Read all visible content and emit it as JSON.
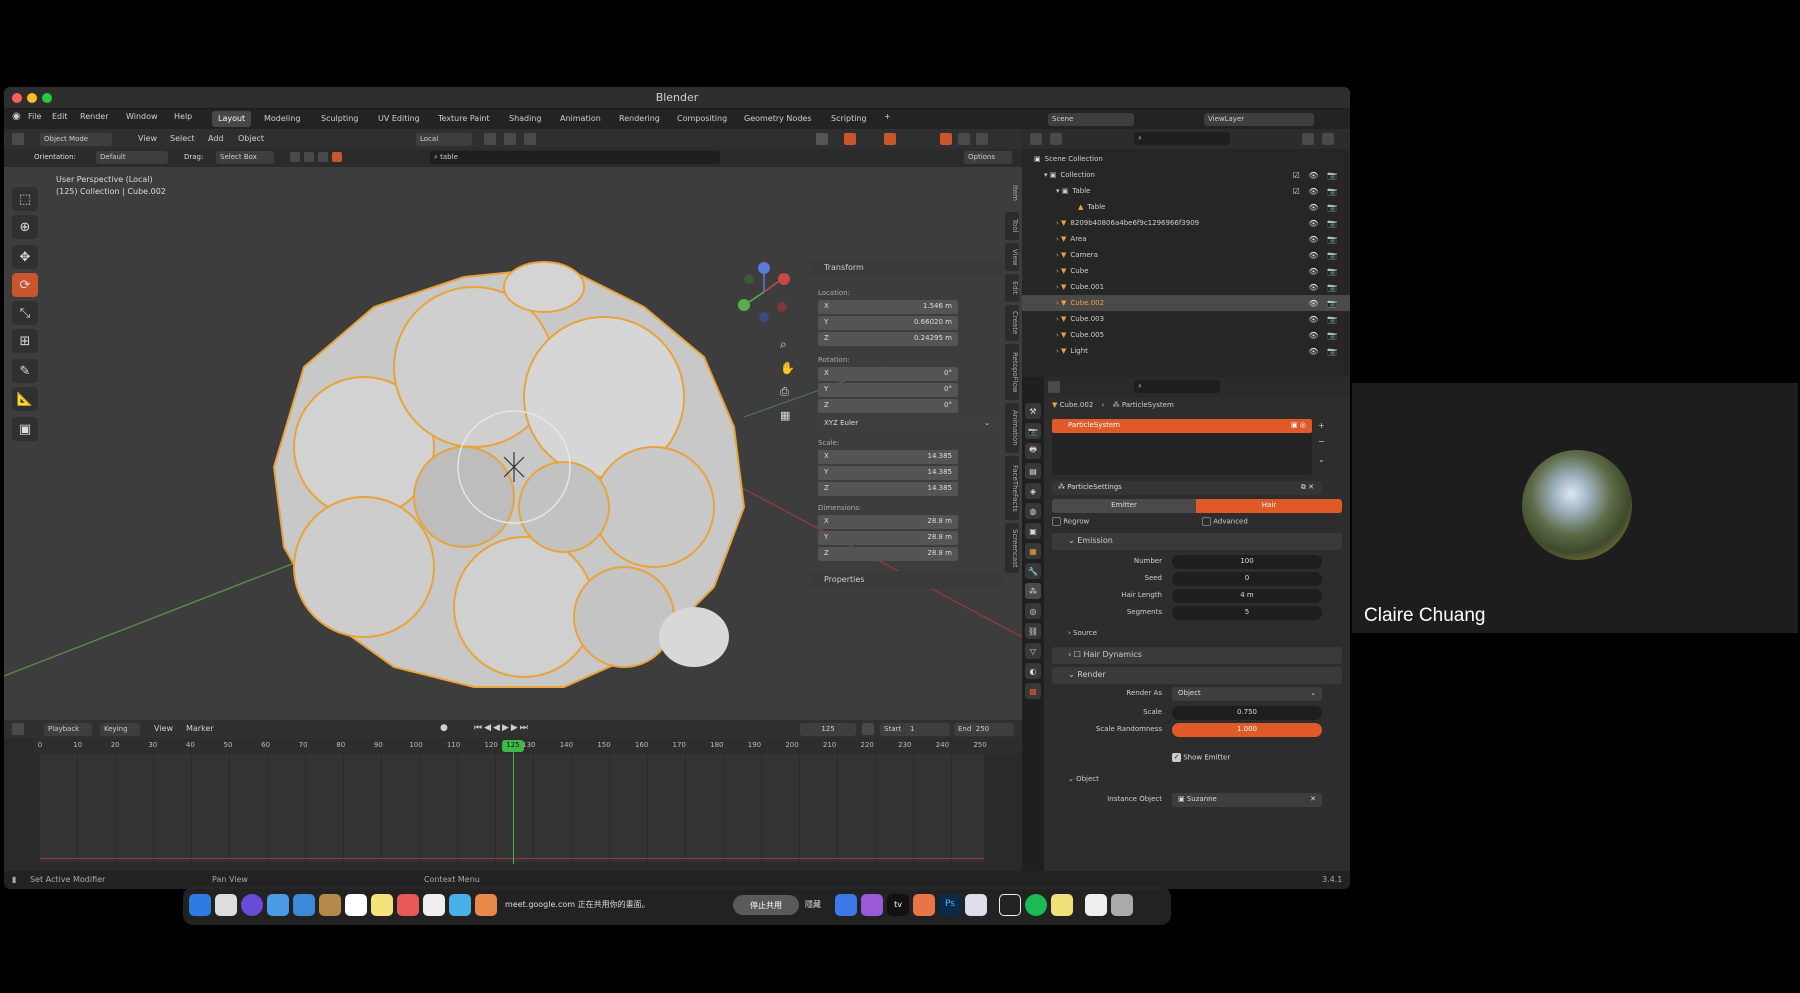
{
  "window": {
    "title": "Blender"
  },
  "menu": [
    "File",
    "Edit",
    "Render",
    "Window",
    "Help"
  ],
  "workspaces": [
    "Layout",
    "Modeling",
    "Sculpting",
    "UV Editing",
    "Texture Paint",
    "Shading",
    "Animation",
    "Rendering",
    "Compositing",
    "Geometry Nodes",
    "Scripting"
  ],
  "topbar": {
    "scene": "Scene",
    "view_layer": "ViewLayer"
  },
  "header": {
    "mode": "Object Mode",
    "view": "View",
    "select": "Select",
    "add": "Add",
    "object": "Object",
    "transform_pivot": "Local",
    "orientation_label": "Orientation:",
    "orientation": "Default",
    "drag_label": "Drag:",
    "drag": "Select Box",
    "options": "Options"
  },
  "viewport": {
    "perspective": "User Perspective (Local)",
    "collection": "(125) Collection | Cube.002"
  },
  "npanel": {
    "header": "Transform",
    "location_label": "Location:",
    "location": [
      {
        "axis": "X",
        "value": "1.546 m"
      },
      {
        "axis": "Y",
        "value": "0.66020 m"
      },
      {
        "axis": "Z",
        "value": "0.24295 m"
      }
    ],
    "rotation_label": "Rotation:",
    "rotation": [
      {
        "axis": "X",
        "value": "0°"
      },
      {
        "axis": "Y",
        "value": "0°"
      },
      {
        "axis": "Z",
        "value": "0°"
      }
    ],
    "rotation_mode": "XYZ Euler",
    "scale_label": "Scale:",
    "scale": [
      {
        "axis": "X",
        "value": "14.385"
      },
      {
        "axis": "Y",
        "value": "14.385"
      },
      {
        "axis": "Z",
        "value": "14.385"
      }
    ],
    "dimensions_label": "Dimensions:",
    "dimensions": [
      {
        "axis": "X",
        "value": "28.8 m"
      },
      {
        "axis": "Y",
        "value": "28.8 m"
      },
      {
        "axis": "Z",
        "value": "28.8 m"
      }
    ],
    "properties": "Properties",
    "tabs": [
      "Item",
      "Tool",
      "View",
      "Edit",
      "Create",
      "RetopoFlow",
      "Animation",
      "FaceTheFacts",
      "Screencast"
    ]
  },
  "timeline": {
    "playback": "Playback",
    "keying": "Keying",
    "view": "View",
    "marker": "Marker",
    "current_frame": "125",
    "start_label": "Start",
    "start": "1",
    "end_label": "End",
    "end": "250",
    "ticks": [
      "0",
      "10",
      "20",
      "30",
      "40",
      "50",
      "60",
      "70",
      "80",
      "90",
      "100",
      "110",
      "120",
      "130",
      "140",
      "150",
      "160",
      "170",
      "180",
      "190",
      "200",
      "210",
      "220",
      "230",
      "240",
      "250"
    ],
    "playhead_label": "125"
  },
  "statusbar": {
    "left": "Set Active Modifier",
    "mid": "Pan View",
    "right": "Context Menu",
    "version": "3.4.1"
  },
  "outliner": {
    "root": "Scene Collection",
    "rows": [
      {
        "name": "Collection",
        "indent": 1
      },
      {
        "name": "Table",
        "indent": 2
      },
      {
        "name": "Table",
        "indent": 3
      },
      {
        "name": "8209b40806a4be6f9c1296966f3909",
        "indent": 2
      },
      {
        "name": "Area",
        "indent": 2
      },
      {
        "name": "Camera",
        "indent": 2
      },
      {
        "name": "Cube",
        "indent": 2
      },
      {
        "name": "Cube.001",
        "indent": 2
      },
      {
        "name": "Cube.002",
        "indent": 2,
        "selected": true
      },
      {
        "name": "Cube.003",
        "indent": 2
      },
      {
        "name": "Cube.005",
        "indent": 2
      },
      {
        "name": "Light",
        "indent": 2
      }
    ]
  },
  "properties": {
    "breadcrumb_object": "Cube.002",
    "breadcrumb_system": "ParticleSystem",
    "system_item": "ParticleSystem",
    "settings_name": "ParticleSettings",
    "type_emitter": "Emitter",
    "type_hair": "Hair",
    "regrow": "Regrow",
    "advanced": "Advanced",
    "emission": "Emission",
    "number_label": "Number",
    "number": "100",
    "seed_label": "Seed",
    "seed": "0",
    "hair_length_label": "Hair Length",
    "hair_length": "4 m",
    "segments_label": "Segments",
    "segments": "5",
    "source": "Source",
    "hair_dynamics": "Hair Dynamics",
    "render": "Render",
    "render_as_label": "Render As",
    "render_as": "Object",
    "scale_label": "Scale",
    "scale": "0.750",
    "scale_random_label": "Scale Randomness",
    "scale_random": "1.000",
    "show_emitter": "Show Emitter",
    "object_sec": "Object",
    "instance_label": "Instance Object",
    "instance": "Suzanne"
  },
  "dock": {
    "meet_text": "meet.google.com 正在共用你的畫面。",
    "stop": "停止共用",
    "hide": "隱藏"
  },
  "participant": {
    "name": "Claire Chuang"
  },
  "colors": {
    "accent": "#e05a28",
    "selection": "#f0a040",
    "bg": "#000000"
  }
}
